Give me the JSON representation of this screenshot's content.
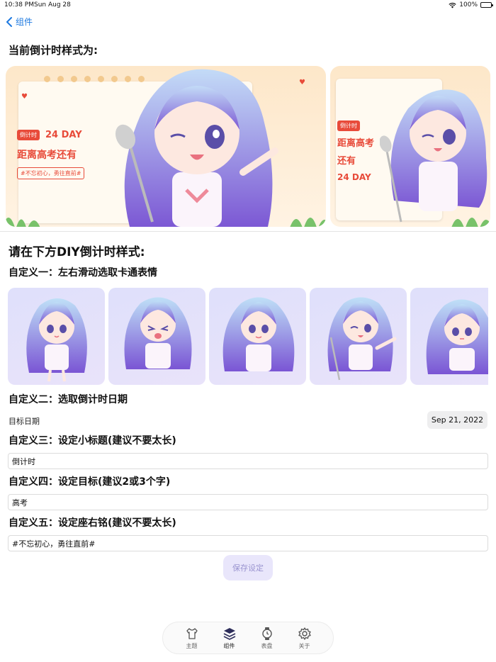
{
  "status": {
    "time": "10:38 PM",
    "date": "Sun Aug 28",
    "battery": "100%",
    "battery_level": 1.0
  },
  "nav": {
    "back_label": "组件"
  },
  "current_style_title": "当前倒计时样式为:",
  "preview": {
    "badge": "倒计时",
    "days": "24 DAY",
    "target_full": "距离高考还有",
    "target_part1": "距离高考",
    "target_part2": "还有",
    "motto": "#不忘初心，勇往直前#"
  },
  "diy_title": "请在下方DIY倒计时样式:",
  "custom1": {
    "title": "自定义一：左右滑动选取卡通表情"
  },
  "custom2": {
    "title": "自定义二：选取倒计时日期",
    "label": "目标日期",
    "date": "Sep 21, 2022"
  },
  "custom3": {
    "title": "自定义三：设定小标题(建议不要太长)",
    "value": "倒计时"
  },
  "custom4": {
    "title": "自定义四：设定目标(建议2或3个字)",
    "value": "高考"
  },
  "custom5": {
    "title": "自定义五：设定座右铭(建议不要太长)",
    "value": "#不忘初心，勇往直前#"
  },
  "save_label": "保存设定",
  "tabs": [
    {
      "label": "主题",
      "icon": "shirt-icon"
    },
    {
      "label": "组件",
      "icon": "layers-icon"
    },
    {
      "label": "表盘",
      "icon": "watch-icon"
    },
    {
      "label": "关于",
      "icon": "gear-icon"
    }
  ],
  "colors": {
    "accent": "#1f7ae0",
    "badge_red": "#e84b3a",
    "hair_top": "#b9d6f5",
    "hair_bottom": "#7e5bd6",
    "save_bg": "#e9e6fb"
  }
}
